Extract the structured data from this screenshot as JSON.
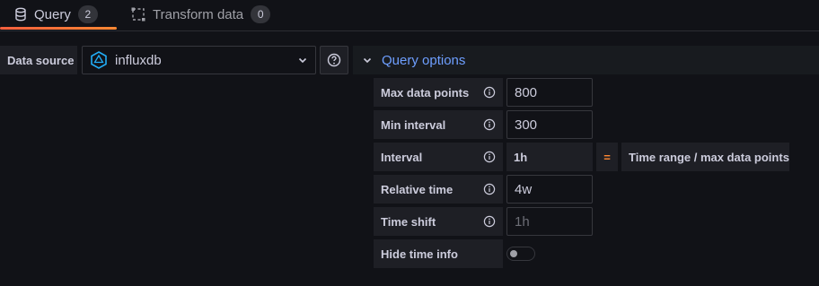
{
  "tabs": [
    {
      "label": "Query",
      "count": "2",
      "icon": "database-icon",
      "active": true
    },
    {
      "label": "Transform data",
      "count": "0",
      "icon": "transform-icon",
      "active": false
    }
  ],
  "datasource": {
    "label": "Data source",
    "selected": "influxdb",
    "icon": "influxdb-logo-icon"
  },
  "query_options": {
    "title": "Query options",
    "expanded": true,
    "max_data_points": {
      "label": "Max data points",
      "value": "800"
    },
    "min_interval": {
      "label": "Min interval",
      "value": "300"
    },
    "interval": {
      "label": "Interval",
      "value": "1h",
      "equals": "=",
      "note": "Time range / max data points"
    },
    "relative_time": {
      "label": "Relative time",
      "value": "4w"
    },
    "time_shift": {
      "label": "Time shift",
      "placeholder": "1h",
      "value": ""
    },
    "hide_time_info": {
      "label": "Hide time info",
      "enabled": false
    }
  },
  "colors": {
    "background": "#111217",
    "accent_link": "#6e9fff",
    "tab_underline": "#ff8833",
    "equals_sign": "#ff8833",
    "influx_logo": "#22adf6"
  }
}
